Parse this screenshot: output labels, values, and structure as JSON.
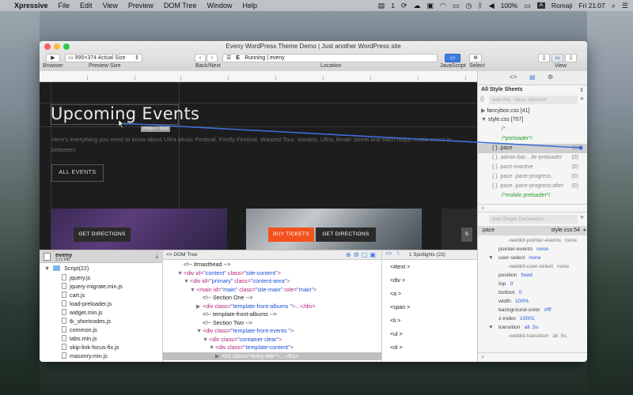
{
  "menubar": {
    "app": "Xpressive",
    "items": [
      "File",
      "Edit",
      "View",
      "Preview",
      "DOM Tree",
      "Window",
      "Help"
    ],
    "battery": "100%",
    "input_flag": "A",
    "input_lang": "Romaji",
    "clock": "Fri 21:07",
    "badge": "1"
  },
  "window": {
    "title": "Eveny WordPress Theme Demo | Just another WordPress site",
    "toolbar": {
      "browser_label": "Browser",
      "preview_size_value": "995×374 Actual Size",
      "preview_size_label": "Preview Size",
      "back_next_label": "Back/Next",
      "url_icon": "E",
      "url_value": "Running | eveny",
      "location_label": "Location",
      "javascript_label": "JavaScript",
      "select_label": "Select",
      "view_label": "View"
    }
  },
  "preview": {
    "heading": "Upcoming Events",
    "size_tag": "247px × 31px",
    "body_text": "Here's everything you need to know about Ultra Music Festival, Firefly Festival, Warped Tour, Voodoo, Ultra, Beale Street and each major music event in between!",
    "all_events_btn": "ALL EVENTS",
    "cards": [
      {
        "buttons": [
          "GET DIRECTIONS"
        ]
      },
      {
        "buttons": [
          "BUY TICKETS",
          "GET DIRECTIONS"
        ]
      },
      {
        "buttons": [
          "S"
        ]
      }
    ]
  },
  "inspector": {
    "tab_icons": [
      "code-icon",
      "document-icon",
      "gear-icon"
    ],
    "sheets_label": "All Style Sheets",
    "search_placeholder": "Add #id, .class, element",
    "sheets": [
      {
        "name": "fancybox.css",
        "count": "[41]"
      },
      {
        "name": "style.css",
        "count": "[707]"
      }
    ],
    "rules": [
      {
        "text": "/*",
        "count": "",
        "style": "green"
      },
      {
        "text": "/*preloader*/",
        "count": "",
        "style": "green"
      },
      {
        "text": "{ } .pace",
        "count": "(0)",
        "style": "sel"
      },
      {
        "text": "{ } .admin-bar....ile-preloader",
        "count": "(0)",
        "style": "grey"
      },
      {
        "text": "{ } .pace-inactive",
        "count": "(0)",
        "style": "grey"
      },
      {
        "text": "{ } .pace .pace-progress",
        "count": "(0)",
        "style": "grey"
      },
      {
        "text": "{ } .pace .pace-progress:after",
        "count": "(0)",
        "style": "grey"
      },
      {
        "text": "/*mobile preloader*/",
        "count": "",
        "style": "green"
      }
    ],
    "decl_placeholder": "Add Single Declaration",
    "selector": ".pace",
    "source": "style.css:54",
    "properties": [
      {
        "k": "-webkit-pointer-events",
        "v": "none",
        "indent": 2,
        "grey": true
      },
      {
        "k": "pointer-events",
        "v": "none",
        "indent": 1
      },
      {
        "k": "user-select",
        "v": "none",
        "indent": 1,
        "caret": true
      },
      {
        "k": "-webkit-user-select",
        "v": "none",
        "indent": 2,
        "grey": true
      },
      {
        "k": "position",
        "v": "fixed",
        "indent": 1
      },
      {
        "k": "top",
        "v": "0",
        "indent": 1
      },
      {
        "k": "bottom",
        "v": "0",
        "indent": 1
      },
      {
        "k": "width",
        "v": "100%",
        "indent": 1
      },
      {
        "k": "background-color",
        "v": "#fff",
        "indent": 1
      },
      {
        "k": "z-index",
        "v": "10001",
        "indent": 1
      },
      {
        "k": "transition",
        "v": "all .5s",
        "indent": 1,
        "caret": true
      },
      {
        "k": "-webkit-transition",
        "v": "all .5s",
        "indent": 2,
        "grey": true
      }
    ]
  },
  "files": {
    "project": "eveny",
    "size": "3.11 MB",
    "folder": "Script(22)",
    "items": [
      "jquery.js",
      "jquery-migrate.min.js",
      "cart.js",
      "load-preloader.js",
      "widget.min.js",
      "tk_shortcodes.js",
      "common.js",
      "tabs.min.js",
      "skip-link-focus-fix.js",
      "masonry.min.js"
    ]
  },
  "dom": {
    "title": "DOM Tree",
    "lines": [
      {
        "indent": 3,
        "tri": "",
        "html": [
          [
            "cm",
            "<!-- #masthead -->"
          ]
        ]
      },
      {
        "indent": 3,
        "tri": "▼",
        "html": [
          [
            "tag",
            "<div "
          ],
          [
            "attr",
            "id="
          ],
          [
            "val",
            "\"content\""
          ],
          [
            "attr",
            " class="
          ],
          [
            "val",
            "\"site-content\""
          ],
          [
            "tag",
            ">"
          ]
        ]
      },
      {
        "indent": 4,
        "tri": "▼",
        "html": [
          [
            "tag",
            "<div "
          ],
          [
            "attr",
            "id="
          ],
          [
            "val",
            "\"primary\""
          ],
          [
            "attr",
            " class="
          ],
          [
            "val",
            "\"content-area\""
          ],
          [
            "tag",
            ">"
          ]
        ]
      },
      {
        "indent": 5,
        "tri": "▼",
        "html": [
          [
            "tag",
            "<main "
          ],
          [
            "attr",
            "id="
          ],
          [
            "val",
            "\"main\""
          ],
          [
            "attr",
            " class="
          ],
          [
            "val",
            "\"site-main\""
          ],
          [
            "attr",
            " role="
          ],
          [
            "val",
            "\"main\""
          ],
          [
            "tag",
            ">"
          ]
        ]
      },
      {
        "indent": 6,
        "tri": "",
        "html": [
          [
            "cm",
            "<!-- Section One -->"
          ]
        ]
      },
      {
        "indent": 6,
        "tri": "▶",
        "html": [
          [
            "tag",
            "<div "
          ],
          [
            "attr",
            "class="
          ],
          [
            "val",
            "\"template-front-albums \""
          ],
          [
            "tag",
            ">...</div>"
          ]
        ]
      },
      {
        "indent": 6,
        "tri": "",
        "html": [
          [
            "cm",
            "<!-- template-front-albums -->"
          ]
        ]
      },
      {
        "indent": 6,
        "tri": "",
        "html": [
          [
            "cm",
            "<!-- Section Two -->"
          ]
        ]
      },
      {
        "indent": 6,
        "tri": "▼",
        "html": [
          [
            "tag",
            "<div "
          ],
          [
            "attr",
            "class="
          ],
          [
            "val",
            "\"template-front-events \""
          ],
          [
            "tag",
            ">"
          ]
        ]
      },
      {
        "indent": 7,
        "tri": "▼",
        "html": [
          [
            "tag",
            "<div "
          ],
          [
            "attr",
            "class="
          ],
          [
            "val",
            "\"container clear\""
          ],
          [
            "tag",
            ">"
          ]
        ]
      },
      {
        "indent": 8,
        "tri": "▼",
        "html": [
          [
            "tag",
            "<div "
          ],
          [
            "attr",
            "class="
          ],
          [
            "val",
            "\"template-content\""
          ],
          [
            "tag",
            ">"
          ]
        ]
      },
      {
        "indent": 9,
        "tri": "▶",
        "sel": true,
        "html": [
          [
            "cm",
            "<h1 class=\"entry-title\">...</h1>"
          ]
        ]
      }
    ]
  },
  "snippets": {
    "title": "1 Spotlights (23)",
    "items": [
      "<#text >",
      "<div >",
      "<a >",
      "<span >",
      "<li >",
      "<ul >",
      "<ol >"
    ]
  }
}
